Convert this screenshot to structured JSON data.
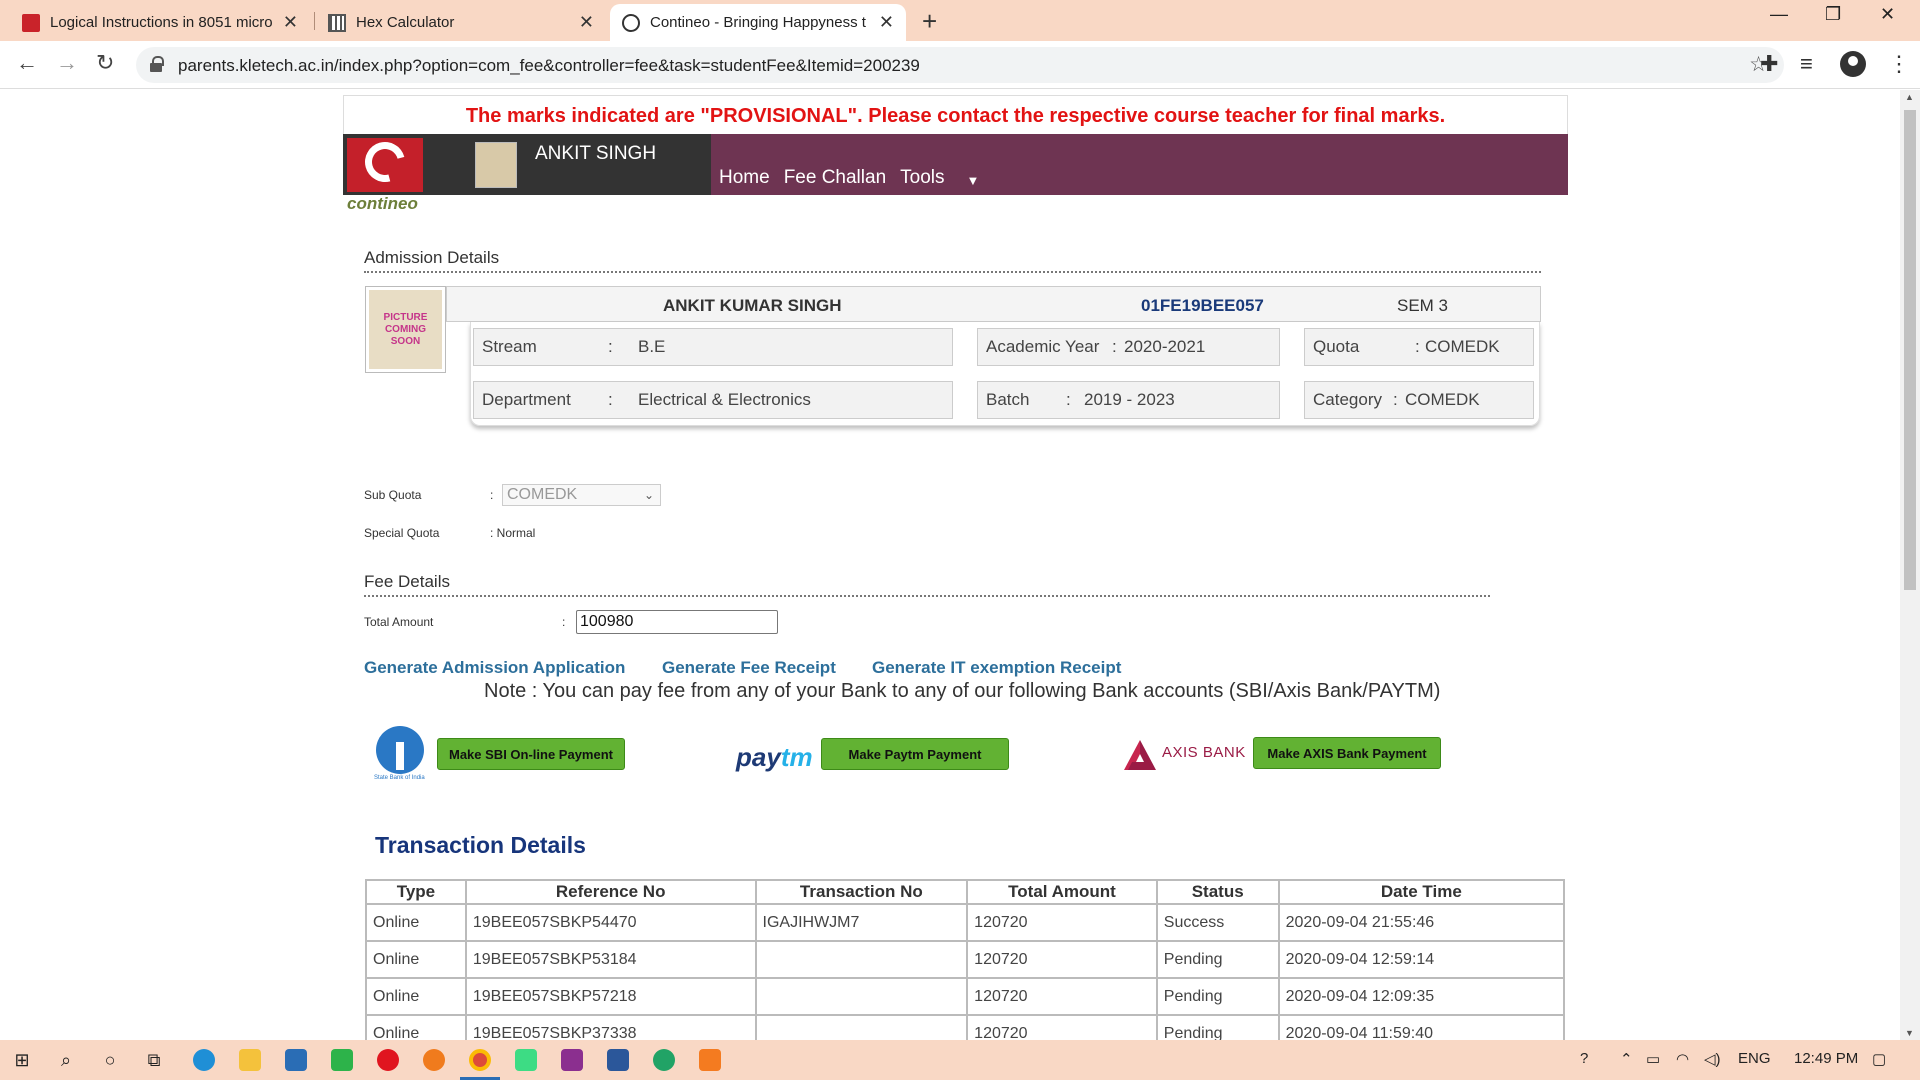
{
  "browser": {
    "tabs": [
      {
        "title": "Logical Instructions in 8051 micro",
        "icon": "document-red-icon"
      },
      {
        "title": "Hex Calculator",
        "icon": "calculator-icon"
      },
      {
        "title": "Contineo - Bringing Happyness t",
        "icon": "globe-icon"
      }
    ],
    "url": "parents.kletech.ac.in/index.php?option=com_fee&controller=fee&task=studentFee&Itemid=200239"
  },
  "page": {
    "notice": "The marks indicated are \"PROVISIONAL\". Please contact the respective course teacher for final marks.",
    "user_name": "ANKIT SINGH",
    "menu": [
      "Home",
      "Fee Challan",
      "Tools"
    ],
    "brand": "contineo",
    "photo_placeholder": "PICTURE COMING SOON",
    "admission": {
      "section_title": "Admission Details",
      "student_name": "ANKIT KUMAR SINGH",
      "usn": "01FE19BEE057",
      "semester": "SEM 3",
      "stream_label": "Stream",
      "stream_value": "B.E",
      "academic_year_label": "Academic Year",
      "academic_year_value": "2020-2021",
      "quota_label": "Quota",
      "quota_value": "COMEDK",
      "department_label": "Department",
      "department_value": "Electrical & Electronics",
      "batch_label": "Batch",
      "batch_value": "2019 - 2023",
      "category_label": "Category",
      "category_value": "COMEDK"
    },
    "sub_quota_label": "Sub Quota",
    "sub_quota_value": "COMEDK",
    "special_quota_label": "Special Quota",
    "special_quota_value": ": Normal",
    "fee": {
      "section_title": "Fee Details",
      "total_amount_label": "Total Amount",
      "total_amount_value": "100980"
    },
    "links": [
      "Generate Admission Application",
      "Generate Fee Receipt",
      "Generate IT exemption Receipt"
    ],
    "note": "Note : You can pay fee from any of your Bank to any of our following Bank accounts (SBI/Axis Bank/PAYTM)",
    "payments": {
      "sbi_caption": "State Bank of India",
      "sbi_button": "Make SBI On-line Payment",
      "paytm_logo_a": "pay",
      "paytm_logo_b": "tm",
      "paytm_button": "Make Paytm Payment",
      "axis_logo": "AXIS BANK",
      "axis_button": "Make AXIS Bank Payment"
    },
    "transactions": {
      "title": "Transaction Details",
      "headers": [
        "Type",
        "Reference No",
        "Transaction No",
        "Total Amount",
        "Status",
        "Date Time"
      ],
      "rows": [
        [
          "Online",
          "19BEE057SBKP54470",
          "IGAJIHWJM7",
          "120720",
          "Success",
          "2020-09-04 21:55:46"
        ],
        [
          "Online",
          "19BEE057SBKP53184",
          "",
          "120720",
          "Pending",
          "2020-09-04 12:59:14"
        ],
        [
          "Online",
          "19BEE057SBKP57218",
          "",
          "120720",
          "Pending",
          "2020-09-04 12:09:35"
        ],
        [
          "Online",
          "19BEE057SBKP37338",
          "",
          "120720",
          "Pending",
          "2020-09-04 11:59:40"
        ]
      ]
    }
  },
  "taskbar": {
    "language": "ENG",
    "time": "12:49 PM"
  },
  "colors": {
    "notice_red": "#e21313",
    "banner_purple": "#6e3452",
    "link_blue": "#2d6f9b",
    "title_navy": "#17357b",
    "pay_green": "#62b233"
  }
}
